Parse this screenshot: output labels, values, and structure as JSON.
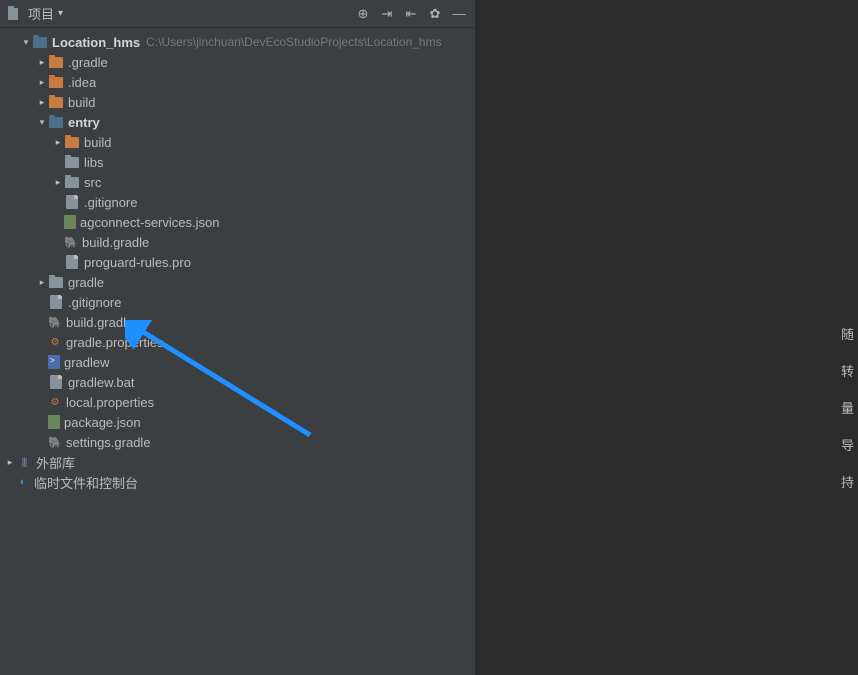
{
  "header": {
    "title": "项目"
  },
  "project": {
    "name": "Location_hms",
    "path": "C:\\Users\\jinchuan\\DevEcoStudioProjects\\Location_hms"
  },
  "tree": [
    {
      "label": ".gradle",
      "indent": 2,
      "arrow": "collapsed",
      "icon": "folder-orange"
    },
    {
      "label": ".idea",
      "indent": 2,
      "arrow": "collapsed",
      "icon": "folder-orange"
    },
    {
      "label": "build",
      "indent": 2,
      "arrow": "collapsed",
      "icon": "folder-orange"
    },
    {
      "label": "entry",
      "indent": 2,
      "arrow": "expanded",
      "icon": "folder-module",
      "bold": true
    },
    {
      "label": "build",
      "indent": 3,
      "arrow": "collapsed",
      "icon": "folder-orange"
    },
    {
      "label": "libs",
      "indent": 3,
      "arrow": "none",
      "icon": "folder-grey"
    },
    {
      "label": "src",
      "indent": 3,
      "arrow": "collapsed",
      "icon": "folder-grey"
    },
    {
      "label": ".gitignore",
      "indent": 3,
      "arrow": "none",
      "icon": "file-generic"
    },
    {
      "label": "agconnect-services.json",
      "indent": 3,
      "arrow": "none",
      "icon": "json-icon"
    },
    {
      "label": "build.gradle",
      "indent": 3,
      "arrow": "none",
      "icon": "gradle-icon"
    },
    {
      "label": "proguard-rules.pro",
      "indent": 3,
      "arrow": "none",
      "icon": "file-generic"
    },
    {
      "label": "gradle",
      "indent": 2,
      "arrow": "collapsed",
      "icon": "folder-grey"
    },
    {
      "label": ".gitignore",
      "indent": 2,
      "arrow": "none",
      "icon": "file-generic"
    },
    {
      "label": "build.gradle",
      "indent": 2,
      "arrow": "none",
      "icon": "gradle-icon"
    },
    {
      "label": "gradle.properties",
      "indent": 2,
      "arrow": "none",
      "icon": "prop-icon"
    },
    {
      "label": "gradlew",
      "indent": 2,
      "arrow": "none",
      "icon": "sh-icon"
    },
    {
      "label": "gradlew.bat",
      "indent": 2,
      "arrow": "none",
      "icon": "file-generic"
    },
    {
      "label": "local.properties",
      "indent": 2,
      "arrow": "none",
      "icon": "prop-icon"
    },
    {
      "label": "package.json",
      "indent": 2,
      "arrow": "none",
      "icon": "json-icon"
    },
    {
      "label": "settings.gradle",
      "indent": 2,
      "arrow": "none",
      "icon": "gradle-icon"
    }
  ],
  "bottom_nodes": {
    "external_libs": "外部库",
    "scratches": "临时文件和控制台"
  },
  "rail": [
    "随",
    "转",
    "量",
    "导",
    "持"
  ]
}
